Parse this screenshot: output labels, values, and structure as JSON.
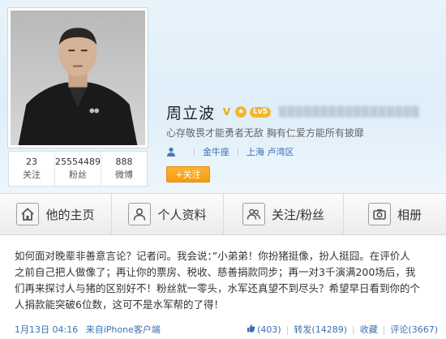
{
  "profile": {
    "name": "周立波",
    "verified_mark": "V",
    "crown_mark": "★",
    "level_badge": "Lv5",
    "blurred_text": "▒▒▒▒▒▒▒▒▒▒▒▒▒▒▒▒▒",
    "motto": "心存敬畏才能勇者无敌 胸有仁爱方能所有披靡",
    "location_tag": "金牛座",
    "location": "上海 卢湾区",
    "follow_label": "+关注"
  },
  "stats": [
    {
      "value": "23",
      "label": "关注"
    },
    {
      "value": "25554489",
      "label": "粉丝"
    },
    {
      "value": "888",
      "label": "微博"
    }
  ],
  "nav": [
    {
      "label": "他的主页",
      "icon": "home-icon"
    },
    {
      "label": "个人资料",
      "icon": "person-icon"
    },
    {
      "label": "关注/粉丝",
      "icon": "people-icon"
    },
    {
      "label": "相册",
      "icon": "camera-icon"
    }
  ],
  "post": {
    "lines": [
      "如何面对晚辈非善意言论？记者问。我会说：”小弟弟！你扮猪挺像，扮人挺囧。在评价人",
      "之前自己把人做像了；再让你的票房、税收、慈善捐款同步；再一对3千演满200场后，我",
      "们再来探讨人与猪的区别好不！粉丝就一零头，水军还真望不到尽头？希望早日看到你的个",
      "人捐款能突破6位数，这可不是水军帮的了得！"
    ],
    "time": "1月13日 04:16",
    "source": "来自iPhone客户端",
    "like_count": "(403)",
    "repost_label": "转发(14289)",
    "favorite_label": "收藏",
    "comment_label": "评论(3667)"
  },
  "colors": {
    "link": "#3a6fb0",
    "follow_button": "#f39c0e",
    "header_bg": "#dfeef9"
  }
}
